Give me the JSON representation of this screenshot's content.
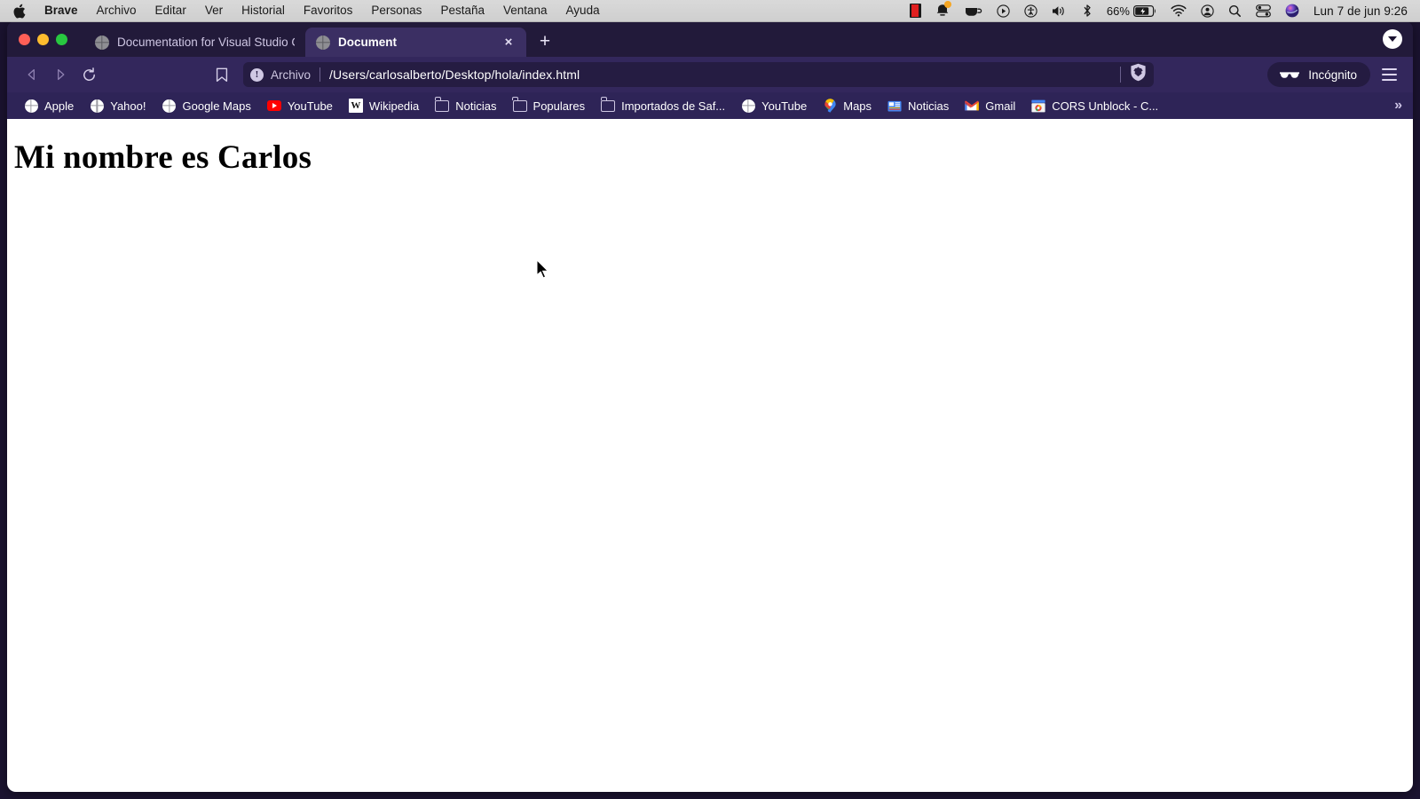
{
  "menubar": {
    "apple_icon": "apple-logo-icon",
    "app_name": "Brave",
    "items": [
      "Archivo",
      "Editar",
      "Ver",
      "Historial",
      "Favoritos",
      "Personas",
      "Pestaña",
      "Ventana",
      "Ayuda"
    ],
    "status_icons": [
      "film-strip-icon",
      "notification-bell-icon",
      "coffee-cup-icon",
      "play-circle-icon",
      "accessibility-circle-icon",
      "volume-icon",
      "bluetooth-icon"
    ],
    "battery_percent": "66%",
    "battery_icon": "battery-charging-icon",
    "right_icons": [
      "wifi-icon",
      "user-account-icon",
      "spotlight-search-icon",
      "control-center-icon",
      "siri-icon"
    ],
    "clock": "Lun 7 de jun  9:26"
  },
  "window": {
    "traffic_lights": {
      "close": "#ff5f57",
      "minimize": "#febc2e",
      "maximize": "#28c840"
    },
    "tabs": [
      {
        "title": "Documentation for Visual Studio Co",
        "favicon": "globe-favicon",
        "active": false
      },
      {
        "title": "Document",
        "favicon": "globe-favicon",
        "active": true,
        "close_label": "×"
      }
    ],
    "new_tab_label": "+",
    "tab_search_icon": "chevron-down-icon"
  },
  "toolbar": {
    "back_icon": "back-arrow-icon",
    "forward_icon": "forward-arrow-icon",
    "reload_icon": "reload-icon",
    "bookmark_icon": "bookmark-icon",
    "url": {
      "info_icon": "info-circle-icon",
      "scheme_label": "Archivo",
      "path": "/Users/carlosalberto/Desktop/hola/index.html",
      "shield_icon": "brave-shield-lion-icon"
    },
    "incognito": {
      "icon": "incognito-glasses-icon",
      "label": "Incógnito"
    },
    "menu_icon": "hamburger-menu-icon"
  },
  "bookmarks": [
    {
      "label": "Apple",
      "icon": "globe-icon"
    },
    {
      "label": "Yahoo!",
      "icon": "globe-icon"
    },
    {
      "label": "Google Maps",
      "icon": "globe-icon"
    },
    {
      "label": "YouTube",
      "icon": "youtube-icon"
    },
    {
      "label": "Wikipedia",
      "icon": "wikipedia-icon",
      "glyph": "W"
    },
    {
      "label": "Noticias",
      "icon": "folder-icon"
    },
    {
      "label": "Populares",
      "icon": "folder-icon"
    },
    {
      "label": "Importados de Saf...",
      "icon": "folder-icon"
    },
    {
      "label": "YouTube",
      "icon": "globe-icon"
    },
    {
      "label": "Maps",
      "icon": "google-maps-pin-icon"
    },
    {
      "label": "Noticias",
      "icon": "google-news-icon"
    },
    {
      "label": "Gmail",
      "icon": "gmail-icon"
    },
    {
      "label": "CORS Unblock - C...",
      "icon": "chrome-webstore-icon"
    }
  ],
  "bookmarks_overflow_label": "»",
  "page": {
    "heading": "Mi nombre es Carlos"
  },
  "colors": {
    "tabstrip": "#221a3a",
    "toolbar": "#33275c",
    "bookmarks_bar": "#2e2457",
    "active_tab": "#3b2f63",
    "urlbar": "#251c42",
    "page_background": "#ffffff"
  }
}
